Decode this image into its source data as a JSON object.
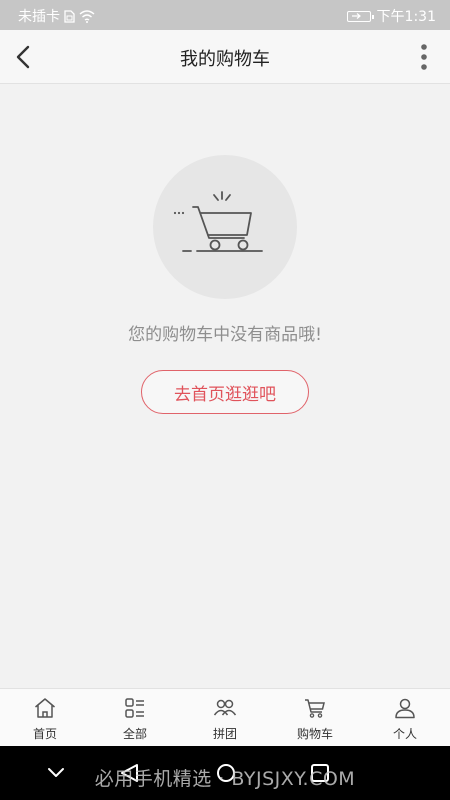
{
  "status_bar": {
    "carrier": "未插卡",
    "time": "下午1:31"
  },
  "nav": {
    "title": "我的购物车"
  },
  "empty_state": {
    "message": "您的购物车中没有商品哦!",
    "button_label": "去首页逛逛吧"
  },
  "tabs": [
    {
      "label": "首页",
      "icon": "home-icon"
    },
    {
      "label": "全部",
      "icon": "category-icon"
    },
    {
      "label": "拼团",
      "icon": "group-icon"
    },
    {
      "label": "购物车",
      "icon": "cart-icon"
    },
    {
      "label": "个人",
      "icon": "user-icon"
    }
  ],
  "watermark": "必用手机精选 · BYJSJXY.COM",
  "colors": {
    "accent": "#e0535b",
    "background": "#f2f2f2"
  }
}
